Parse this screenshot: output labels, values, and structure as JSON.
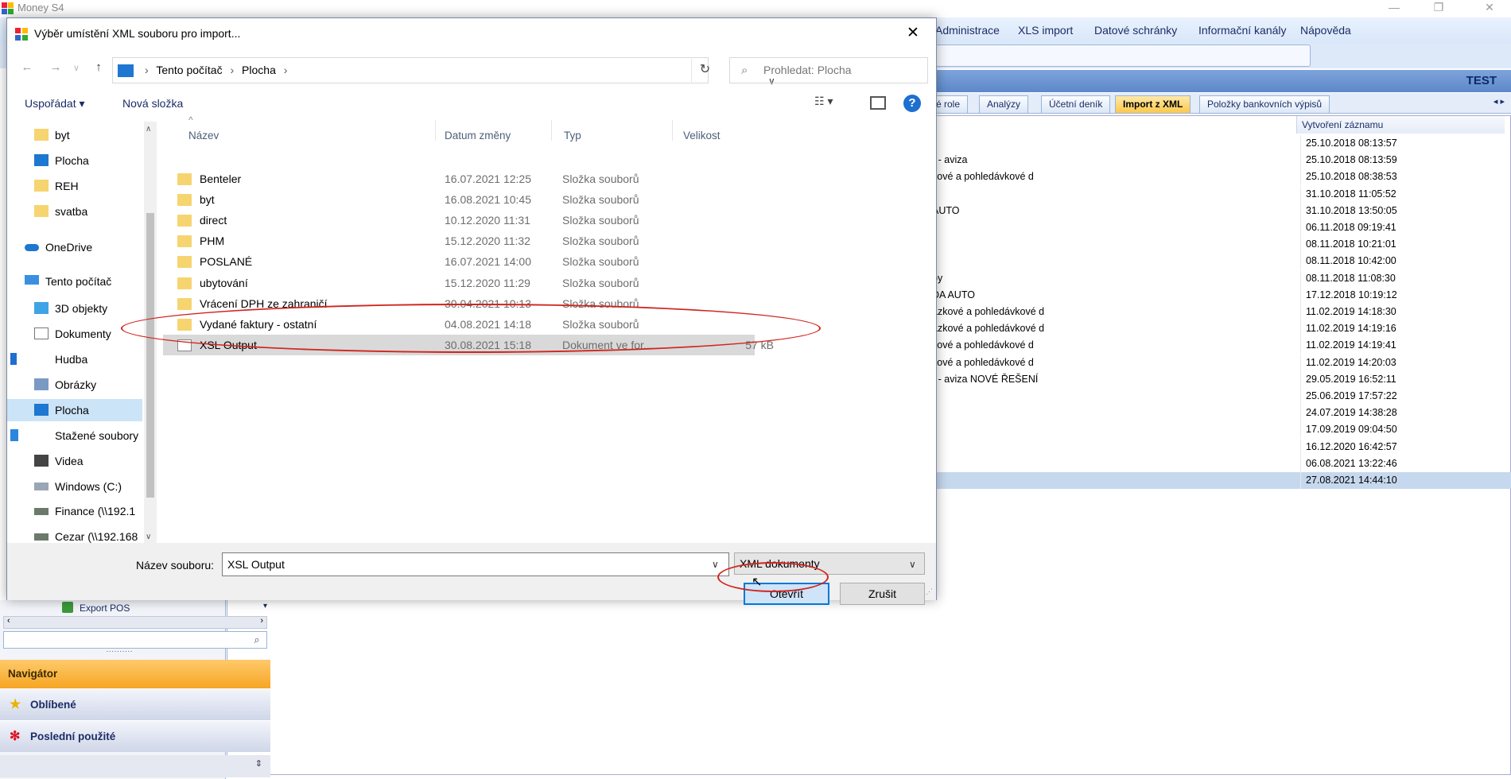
{
  "app": {
    "title": "Money S4",
    "menu": [
      "Administrace",
      "XLS import",
      "Datové schránky",
      "Informační kanály",
      "Nápověda"
    ],
    "environment_label": "TEST",
    "tabs": [
      {
        "label": "ké role",
        "active": false
      },
      {
        "label": "Analýzy",
        "active": false
      },
      {
        "label": "Účetní deník",
        "active": false
      },
      {
        "label": "Import z XML",
        "active": true
      },
      {
        "label": "Položky bankovních výpisů",
        "active": false
      }
    ],
    "grid": {
      "date_column": "Vytvoření záznamu",
      "rows": [
        {
          "desc": "",
          "date": "25.10.2018 08:13:57"
        },
        {
          "desc": "r - aviza",
          "date": "25.10.2018 08:13:59"
        },
        {
          "desc": "kové a pohledávkové d",
          "date": "25.10.2018 08:38:53"
        },
        {
          "desc": "",
          "date": "31.10.2018 11:05:52"
        },
        {
          "desc": "AUTO",
          "date": "31.10.2018 13:50:05"
        },
        {
          "desc": "",
          "date": "06.11.2018 09:19:41"
        },
        {
          "desc": "",
          "date": "08.11.2018 10:21:01"
        },
        {
          "desc": "",
          "date": "08.11.2018 10:42:00"
        },
        {
          "desc": "by",
          "date": "08.11.2018 11:08:30"
        },
        {
          "desc": "DA AUTO",
          "date": "17.12.2018 10:19:12"
        },
        {
          "desc": "azkové a pohledávkové d",
          "date": "11.02.2019 14:18:30"
        },
        {
          "desc": "azkové a pohledávkové d",
          "date": "11.02.2019 14:19:16"
        },
        {
          "desc": "kové a pohledávkové d",
          "date": "11.02.2019 14:19:41"
        },
        {
          "desc": "kové a pohledávkové d",
          "date": "11.02.2019 14:20:03"
        },
        {
          "desc": "r - aviza NOVÉ ŘEŠENÍ",
          "date": "29.05.2019 16:52:11"
        },
        {
          "desc": "",
          "date": "25.06.2019 17:57:22"
        },
        {
          "desc": "",
          "date": "24.07.2019 14:38:28"
        },
        {
          "desc": "",
          "date": "17.09.2019 09:04:50"
        },
        {
          "desc": "",
          "date": "16.12.2020 16:42:57"
        },
        {
          "desc": "",
          "date": "06.08.2021 13:22:46"
        },
        {
          "desc": "",
          "date": "27.08.2021 14:44:10",
          "selected": true
        }
      ]
    },
    "sidebar": {
      "export_item": "Export POS",
      "navigator_title": "Navigátor",
      "sections": [
        "Oblíbené",
        "Poslední použité"
      ]
    }
  },
  "dialog": {
    "title": "Výběr umístění XML souboru pro import...",
    "breadcrumb": [
      "Tento počítač",
      "Plocha"
    ],
    "search_placeholder": "Prohledat: Plocha",
    "commands": {
      "organize": "Uspořádat",
      "new_folder": "Nová složka"
    },
    "tree": [
      {
        "label": "byt",
        "icon": "folder"
      },
      {
        "label": "Plocha",
        "icon": "desktop"
      },
      {
        "label": "REH",
        "icon": "folder"
      },
      {
        "label": "svatba",
        "icon": "folder"
      },
      {
        "label": "OneDrive",
        "icon": "cloud"
      },
      {
        "label": "Tento počítač",
        "icon": "computer"
      },
      {
        "label": "3D objekty",
        "icon": "cube"
      },
      {
        "label": "Dokumenty",
        "icon": "document"
      },
      {
        "label": "Hudba",
        "icon": "music"
      },
      {
        "label": "Obrázky",
        "icon": "picture"
      },
      {
        "label": "Plocha",
        "icon": "desktop",
        "selected": true
      },
      {
        "label": "Stažené soubory",
        "icon": "download"
      },
      {
        "label": "Videa",
        "icon": "video"
      },
      {
        "label": "Windows  (C:)",
        "icon": "drive"
      },
      {
        "label": "Finance (\\\\192.1",
        "icon": "network-drive"
      },
      {
        "label": "Cezar (\\\\192.168",
        "icon": "network-drive"
      }
    ],
    "columns": {
      "name": "Název",
      "date": "Datum změny",
      "type": "Typ",
      "size": "Velikost"
    },
    "files": [
      {
        "name": "Benteler",
        "date": "16.07.2021 12:25",
        "type": "Složka souborů",
        "size": "",
        "icon": "folder"
      },
      {
        "name": "byt",
        "date": "16.08.2021 10:45",
        "type": "Složka souborů",
        "size": "",
        "icon": "folder"
      },
      {
        "name": "direct",
        "date": "10.12.2020 11:31",
        "type": "Složka souborů",
        "size": "",
        "icon": "folder"
      },
      {
        "name": "PHM",
        "date": "15.12.2020 11:32",
        "type": "Složka souborů",
        "size": "",
        "icon": "folder"
      },
      {
        "name": "POSLANÉ",
        "date": "16.07.2021 14:00",
        "type": "Složka souborů",
        "size": "",
        "icon": "folder"
      },
      {
        "name": "ubytování",
        "date": "15.12.2020 11:29",
        "type": "Složka souborů",
        "size": "",
        "icon": "folder"
      },
      {
        "name": "Vrácení DPH ze zahraničí",
        "date": "30.04.2021 10:13",
        "type": "Složka souborů",
        "size": "",
        "icon": "folder"
      },
      {
        "name": "Vydané faktury - ostatní",
        "date": "04.08.2021 14:18",
        "type": "Složka souborů",
        "size": "",
        "icon": "folder"
      },
      {
        "name": "XSL Output",
        "date": "30.08.2021 15:18",
        "type": "Dokument ve for...",
        "size": "57 kB",
        "icon": "document",
        "selected": true
      }
    ],
    "filename_label": "Název souboru:",
    "filename_value": "XSL Output",
    "filetype_value": "XML dokumenty",
    "open_label": "Otevřít",
    "cancel_label": "Zrušit"
  }
}
